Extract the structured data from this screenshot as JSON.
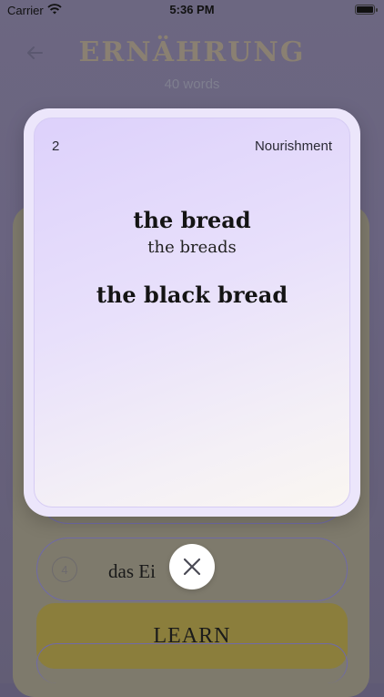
{
  "status_bar": {
    "carrier": "Carrier",
    "time": "5:36 PM"
  },
  "header": {
    "title": "ERNÄHRUNG",
    "subtitle": "40 words"
  },
  "list": {
    "items": [
      {
        "number": "4",
        "word": "das Ei"
      }
    ]
  },
  "learn_button": {
    "label": "LEARN"
  },
  "flashcard": {
    "number": "2",
    "category": "Nourishment",
    "word": "the bread",
    "plural": "the breads",
    "example": "the black bread"
  },
  "icons": {
    "back": "arrow-left-icon",
    "close": "close-icon",
    "wifi": "wifi-icon",
    "battery": "battery-icon"
  },
  "colors": {
    "overlay_dim": "#625d75",
    "card_gradient_start": "#ddd1fb",
    "card_gradient_end": "#faf6f1",
    "learn_button": "#8b7e3c"
  }
}
